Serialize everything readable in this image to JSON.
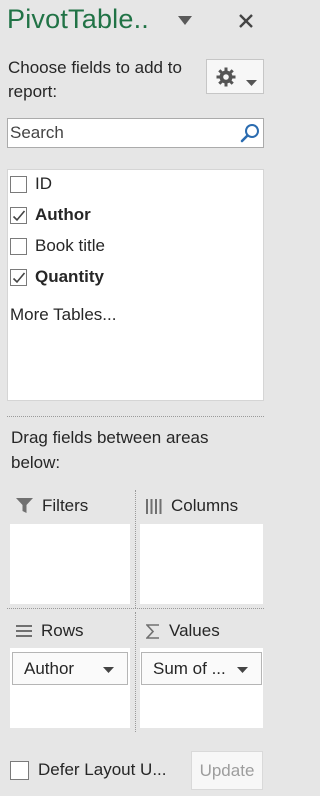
{
  "pane": {
    "title": "PivotTable..",
    "dropdown_icon": "triangle-down-icon",
    "close_icon": "close-icon"
  },
  "choose_fields": {
    "label": "Choose fields to add to report:",
    "settings_icon": "gear-icon"
  },
  "search": {
    "placeholder": "Search",
    "value": "",
    "icon": "search-icon"
  },
  "fields": [
    {
      "label": "ID",
      "checked": false
    },
    {
      "label": "Author",
      "checked": true
    },
    {
      "label": "Book title",
      "checked": false
    },
    {
      "label": "Quantity",
      "checked": true
    }
  ],
  "more_tables": "More Tables...",
  "drag_text": "Drag fields between areas below:",
  "areas": {
    "filters": {
      "label": "Filters",
      "icon": "filter-icon"
    },
    "columns": {
      "label": "Columns",
      "icon": "columns-icon",
      "items": []
    },
    "rows": {
      "label": "Rows",
      "icon": "rows-icon",
      "items": [
        "Author"
      ]
    },
    "values": {
      "label": "Values",
      "icon": "sigma-icon",
      "items": [
        "Sum of ..."
      ]
    }
  },
  "footer": {
    "defer_label": "Defer Layout U...",
    "defer_checked": false,
    "update_label": "Update"
  },
  "colors": {
    "title_green": "#217346",
    "pane_background": "#e6e6e6"
  }
}
